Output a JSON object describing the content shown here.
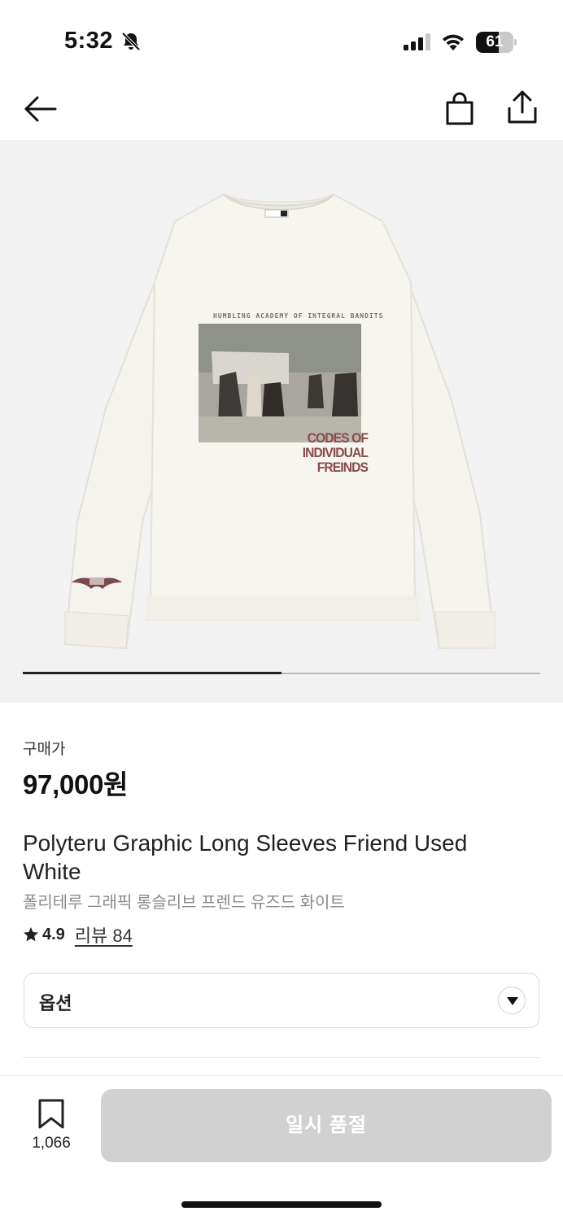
{
  "status_bar": {
    "time": "5:32",
    "battery_level": "61",
    "battery_fraction": 0.61,
    "icons": [
      "bell-slash-icon",
      "cellular-signal-icon",
      "wifi-icon",
      "battery-icon"
    ]
  },
  "nav": {
    "icons": [
      "back-arrow-icon",
      "shopping-bag-icon",
      "share-icon"
    ]
  },
  "gallery": {
    "image_alt": "Polyteru Graphic Long Sleeves Friend Used White",
    "print_header": "HUMBLING ACADEMY OF INTEGRAL BANDITS",
    "print_lines": [
      "CODES OF",
      "INDIVIDUAL",
      "FREINDS"
    ],
    "image_count": 2,
    "current_image": 1,
    "colors": {
      "background": "#f2f2f2",
      "shirt": "#f7f5ef",
      "print_text": "#8a4a48"
    }
  },
  "product": {
    "price_label": "구매가",
    "price": "97,000원",
    "name_en": "Polyteru Graphic Long Sleeves Friend Used White",
    "name_ko": "폴리테루 그래픽 롱슬리브 프렌드 유즈드 화이트",
    "rating": "4.9",
    "review_link": "리뷰 84"
  },
  "option": {
    "label": "옵션"
  },
  "bottom_bar": {
    "wishlist_count": "1,066",
    "soldout_label": "일시 품절",
    "colors": {
      "soldout_bg": "#d1d1d1"
    }
  }
}
